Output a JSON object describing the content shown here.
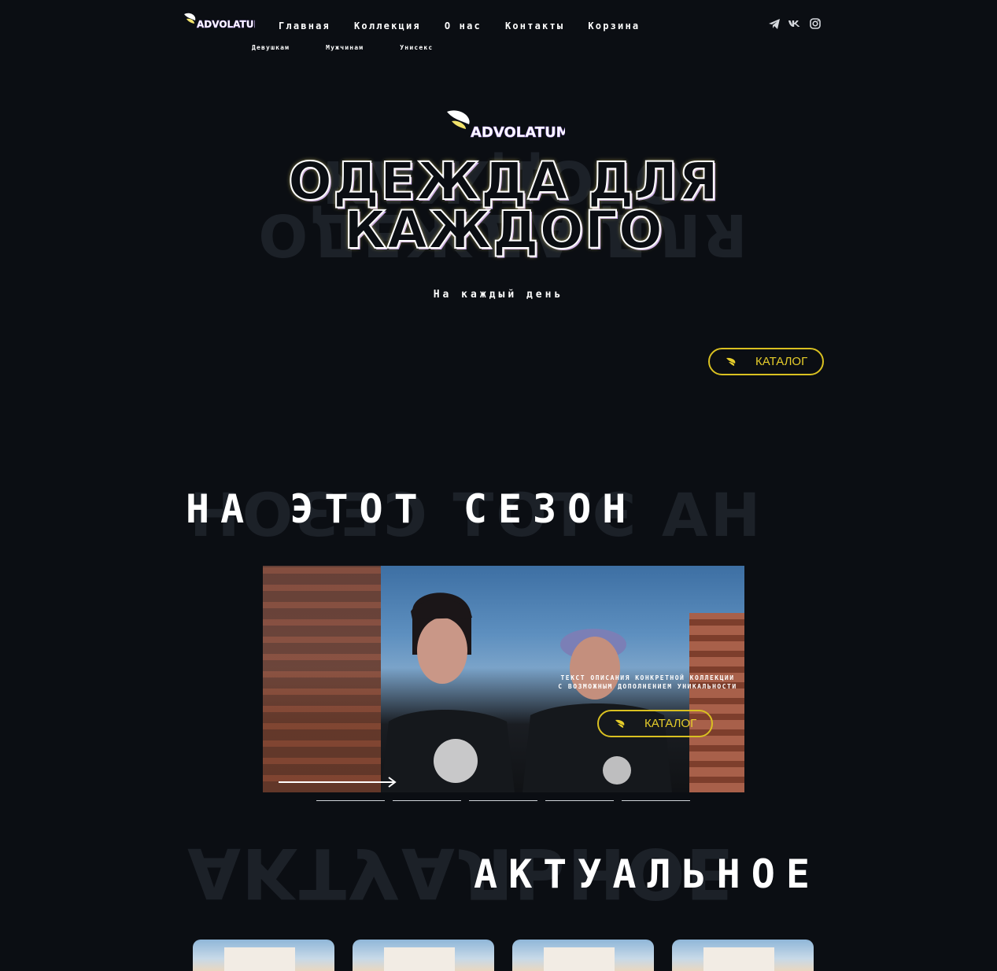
{
  "brand": {
    "logo_text": "ADVOLATUM"
  },
  "nav": {
    "items": [
      "Главная",
      "Коллекция",
      "О нас",
      "Контакты",
      "Корзина"
    ],
    "sub_items": [
      "Девушкам",
      "Мужчинам",
      "Унисекс"
    ]
  },
  "socials": [
    "telegram-icon",
    "vk-icon",
    "instagram-icon"
  ],
  "hero": {
    "title_line1": "ОДЕЖДА ДЛЯ",
    "title_line2": "КАЖДОГО",
    "subtitle": "На каждый день",
    "button_label": "КАТАЛОГ"
  },
  "season": {
    "title": "НА ЭТОТ СЕЗОН",
    "slide_text": "ТЕКСТ ОПИСАНИЯ КОНКРЕТНОЙ КОЛЛЕКЦИИ С ВОЗМОЖНЫМ ДОПОЛНЕНИЕМ УНИКАЛЬНОСТИ",
    "button_label": "КАТАЛОГ",
    "slide_count": 5
  },
  "actual": {
    "title": "АКТУАЛЬНОЕ"
  },
  "colors": {
    "background": "#0b0e13",
    "accent": "#d9c021",
    "ghost": "#1c2128"
  }
}
